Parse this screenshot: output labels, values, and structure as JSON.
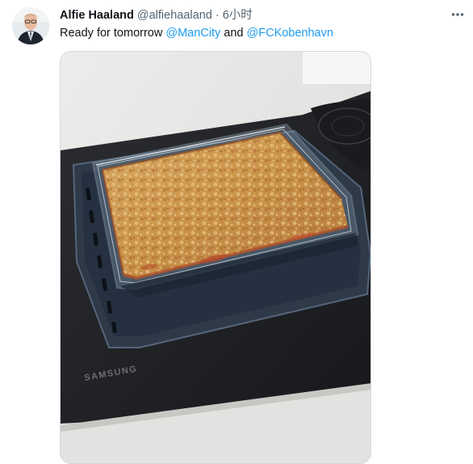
{
  "author": {
    "name": "Alfie Haaland",
    "handle": "@alfiehaaland",
    "separator": "·",
    "time": "6小时"
  },
  "tweet": {
    "text_before": "Ready for tomorrow ",
    "mention1": "@ManCity",
    "text_middle": " and ",
    "mention2": "@FCKobenhavn"
  },
  "photo": {
    "oven_brand": "SAMSUNG"
  },
  "icons": {
    "more": "more-dots-icon",
    "avatar": "avatar"
  },
  "colors": {
    "link": "#1d9bf0",
    "secondary_text": "#536471",
    "border": "#cfd9de"
  }
}
